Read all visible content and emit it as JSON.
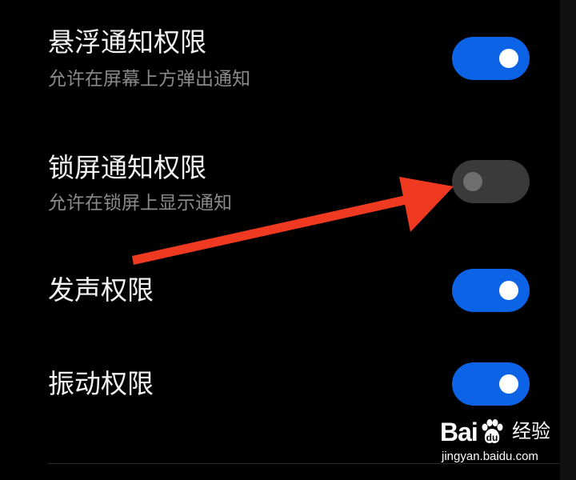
{
  "settings": {
    "items": [
      {
        "title": "悬浮通知权限",
        "subtitle": "允许在屏幕上方弹出通知",
        "enabled": true
      },
      {
        "title": "锁屏通知权限",
        "subtitle": "允许在锁屏上显示通知",
        "enabled": false
      },
      {
        "title": "发声权限",
        "enabled": true
      },
      {
        "title": "振动权限",
        "enabled": true
      }
    ]
  },
  "colors": {
    "background": "#000000",
    "toggle_on": "#0d63e6",
    "toggle_off": "#3a3a3a",
    "arrow": "#ef3a21",
    "subtitle_text": "#8a8a8a"
  },
  "watermark": {
    "logo_prefix": "Bai",
    "logo_suffix": "经验",
    "url": "jingyan.baidu.com"
  }
}
